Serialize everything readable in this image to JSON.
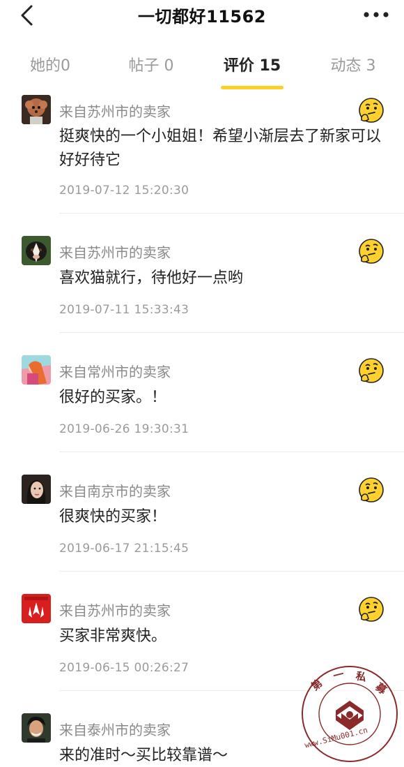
{
  "header": {
    "title": "一切都好11562"
  },
  "tabs": [
    {
      "label": "她的0",
      "active": false
    },
    {
      "label": "帖子 0",
      "active": false
    },
    {
      "label": "评价 15",
      "active": true
    },
    {
      "label": "动态 3",
      "active": false
    }
  ],
  "reviews": [
    {
      "source": "来自苏州市的卖家",
      "content": "挺爽快的一个小姐姐！希望小渐层去了新家可以好好待它",
      "time": "2019-07-12 15:20:30"
    },
    {
      "source": "来自苏州市的卖家",
      "content": "喜欢猫就行，待他好一点哟",
      "time": "2019-07-11 15:33:43"
    },
    {
      "source": "来自常州市的卖家",
      "content": "很好的买家。！",
      "time": "2019-06-26 19:30:31"
    },
    {
      "source": "来自南京市的卖家",
      "content": "很爽快的买家！",
      "time": "2019-06-17 21:15:45"
    },
    {
      "source": "来自苏州市的卖家",
      "content": "买家非常爽快。",
      "time": "2019-06-15 00:26:27"
    },
    {
      "source": "来自泰州市的卖家",
      "content": "来的准时～买比较靠谱～",
      "time": ""
    }
  ],
  "watermark": {
    "chars": [
      "第",
      "一",
      "私",
      "募"
    ],
    "url": "www.SiMu001.cn"
  },
  "icons": {
    "back": "chevron-left-icon",
    "more": "more-dots-icon",
    "emoji": "thinking-face-icon"
  },
  "colors": {
    "accent": "#ffcf26",
    "stamp": "#8a2a2a"
  }
}
